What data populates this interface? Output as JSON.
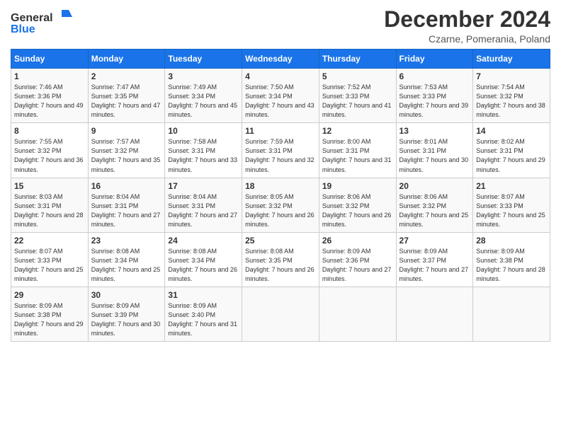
{
  "logo": {
    "general": "General",
    "blue": "Blue"
  },
  "title": "December 2024",
  "subtitle": "Czarne, Pomerania, Poland",
  "days_header": [
    "Sunday",
    "Monday",
    "Tuesday",
    "Wednesday",
    "Thursday",
    "Friday",
    "Saturday"
  ],
  "weeks": [
    [
      {
        "day": "1",
        "sunrise": "Sunrise: 7:46 AM",
        "sunset": "Sunset: 3:36 PM",
        "daylight": "Daylight: 7 hours and 49 minutes."
      },
      {
        "day": "2",
        "sunrise": "Sunrise: 7:47 AM",
        "sunset": "Sunset: 3:35 PM",
        "daylight": "Daylight: 7 hours and 47 minutes."
      },
      {
        "day": "3",
        "sunrise": "Sunrise: 7:49 AM",
        "sunset": "Sunset: 3:34 PM",
        "daylight": "Daylight: 7 hours and 45 minutes."
      },
      {
        "day": "4",
        "sunrise": "Sunrise: 7:50 AM",
        "sunset": "Sunset: 3:34 PM",
        "daylight": "Daylight: 7 hours and 43 minutes."
      },
      {
        "day": "5",
        "sunrise": "Sunrise: 7:52 AM",
        "sunset": "Sunset: 3:33 PM",
        "daylight": "Daylight: 7 hours and 41 minutes."
      },
      {
        "day": "6",
        "sunrise": "Sunrise: 7:53 AM",
        "sunset": "Sunset: 3:33 PM",
        "daylight": "Daylight: 7 hours and 39 minutes."
      },
      {
        "day": "7",
        "sunrise": "Sunrise: 7:54 AM",
        "sunset": "Sunset: 3:32 PM",
        "daylight": "Daylight: 7 hours and 38 minutes."
      }
    ],
    [
      {
        "day": "8",
        "sunrise": "Sunrise: 7:55 AM",
        "sunset": "Sunset: 3:32 PM",
        "daylight": "Daylight: 7 hours and 36 minutes."
      },
      {
        "day": "9",
        "sunrise": "Sunrise: 7:57 AM",
        "sunset": "Sunset: 3:32 PM",
        "daylight": "Daylight: 7 hours and 35 minutes."
      },
      {
        "day": "10",
        "sunrise": "Sunrise: 7:58 AM",
        "sunset": "Sunset: 3:31 PM",
        "daylight": "Daylight: 7 hours and 33 minutes."
      },
      {
        "day": "11",
        "sunrise": "Sunrise: 7:59 AM",
        "sunset": "Sunset: 3:31 PM",
        "daylight": "Daylight: 7 hours and 32 minutes."
      },
      {
        "day": "12",
        "sunrise": "Sunrise: 8:00 AM",
        "sunset": "Sunset: 3:31 PM",
        "daylight": "Daylight: 7 hours and 31 minutes."
      },
      {
        "day": "13",
        "sunrise": "Sunrise: 8:01 AM",
        "sunset": "Sunset: 3:31 PM",
        "daylight": "Daylight: 7 hours and 30 minutes."
      },
      {
        "day": "14",
        "sunrise": "Sunrise: 8:02 AM",
        "sunset": "Sunset: 3:31 PM",
        "daylight": "Daylight: 7 hours and 29 minutes."
      }
    ],
    [
      {
        "day": "15",
        "sunrise": "Sunrise: 8:03 AM",
        "sunset": "Sunset: 3:31 PM",
        "daylight": "Daylight: 7 hours and 28 minutes."
      },
      {
        "day": "16",
        "sunrise": "Sunrise: 8:04 AM",
        "sunset": "Sunset: 3:31 PM",
        "daylight": "Daylight: 7 hours and 27 minutes."
      },
      {
        "day": "17",
        "sunrise": "Sunrise: 8:04 AM",
        "sunset": "Sunset: 3:31 PM",
        "daylight": "Daylight: 7 hours and 27 minutes."
      },
      {
        "day": "18",
        "sunrise": "Sunrise: 8:05 AM",
        "sunset": "Sunset: 3:32 PM",
        "daylight": "Daylight: 7 hours and 26 minutes."
      },
      {
        "day": "19",
        "sunrise": "Sunrise: 8:06 AM",
        "sunset": "Sunset: 3:32 PM",
        "daylight": "Daylight: 7 hours and 26 minutes."
      },
      {
        "day": "20",
        "sunrise": "Sunrise: 8:06 AM",
        "sunset": "Sunset: 3:32 PM",
        "daylight": "Daylight: 7 hours and 25 minutes."
      },
      {
        "day": "21",
        "sunrise": "Sunrise: 8:07 AM",
        "sunset": "Sunset: 3:33 PM",
        "daylight": "Daylight: 7 hours and 25 minutes."
      }
    ],
    [
      {
        "day": "22",
        "sunrise": "Sunrise: 8:07 AM",
        "sunset": "Sunset: 3:33 PM",
        "daylight": "Daylight: 7 hours and 25 minutes."
      },
      {
        "day": "23",
        "sunrise": "Sunrise: 8:08 AM",
        "sunset": "Sunset: 3:34 PM",
        "daylight": "Daylight: 7 hours and 25 minutes."
      },
      {
        "day": "24",
        "sunrise": "Sunrise: 8:08 AM",
        "sunset": "Sunset: 3:34 PM",
        "daylight": "Daylight: 7 hours and 26 minutes."
      },
      {
        "day": "25",
        "sunrise": "Sunrise: 8:08 AM",
        "sunset": "Sunset: 3:35 PM",
        "daylight": "Daylight: 7 hours and 26 minutes."
      },
      {
        "day": "26",
        "sunrise": "Sunrise: 8:09 AM",
        "sunset": "Sunset: 3:36 PM",
        "daylight": "Daylight: 7 hours and 27 minutes."
      },
      {
        "day": "27",
        "sunrise": "Sunrise: 8:09 AM",
        "sunset": "Sunset: 3:37 PM",
        "daylight": "Daylight: 7 hours and 27 minutes."
      },
      {
        "day": "28",
        "sunrise": "Sunrise: 8:09 AM",
        "sunset": "Sunset: 3:38 PM",
        "daylight": "Daylight: 7 hours and 28 minutes."
      }
    ],
    [
      {
        "day": "29",
        "sunrise": "Sunrise: 8:09 AM",
        "sunset": "Sunset: 3:38 PM",
        "daylight": "Daylight: 7 hours and 29 minutes."
      },
      {
        "day": "30",
        "sunrise": "Sunrise: 8:09 AM",
        "sunset": "Sunset: 3:39 PM",
        "daylight": "Daylight: 7 hours and 30 minutes."
      },
      {
        "day": "31",
        "sunrise": "Sunrise: 8:09 AM",
        "sunset": "Sunset: 3:40 PM",
        "daylight": "Daylight: 7 hours and 31 minutes."
      },
      null,
      null,
      null,
      null
    ]
  ]
}
